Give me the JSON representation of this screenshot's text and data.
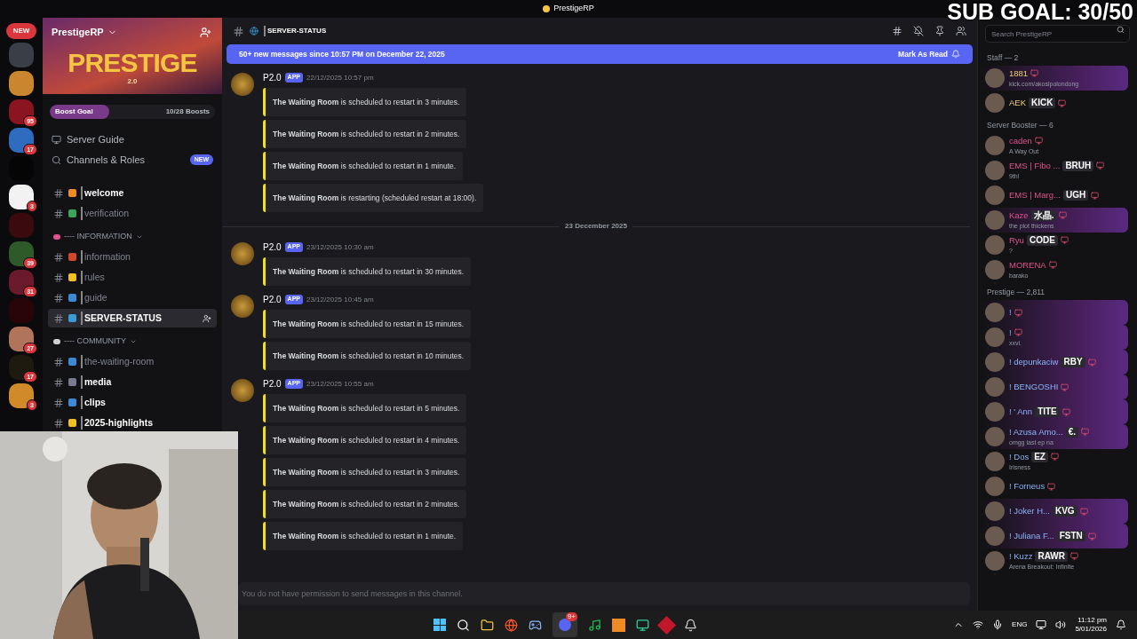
{
  "window": {
    "title": "PrestigeRP"
  },
  "overlay": {
    "sub_goal": "SUB GOAL: 30/50"
  },
  "rail": {
    "new_label": "NEW",
    "servers": [
      {
        "color": "#3a3f47"
      },
      {
        "color": "#c9862f"
      },
      {
        "color": "#8a1420",
        "badge": "95"
      },
      {
        "color": "#2f6bbf",
        "badge": "17"
      },
      {
        "color": "#050505"
      },
      {
        "color": "#f2f2f2",
        "badge": "3"
      },
      {
        "color": "#3a0a0e"
      },
      {
        "color": "#2e5a2a",
        "badge": "39"
      },
      {
        "color": "#6a1a2a",
        "badge": "31"
      },
      {
        "color": "#2a0508"
      },
      {
        "color": "#b0745a",
        "badge": "27"
      },
      {
        "color": "#1e1a10",
        "badge": "17"
      },
      {
        "color": "#d08a2a",
        "badge": "3"
      }
    ]
  },
  "server": {
    "name": "PrestigeRP",
    "banner_title": "PRESTIGE",
    "banner_sub": "2.0",
    "boost_label": "Boost Goal",
    "boost_count": "10/28 Boosts",
    "level": 0.36,
    "links": [
      {
        "label": "Server Guide"
      },
      {
        "label": "Channels & Roles",
        "badge": "NEW"
      }
    ]
  },
  "channels": [
    {
      "kind": "channel",
      "name": "welcome",
      "color": "#f08a24",
      "unread": true,
      "selected": false
    },
    {
      "kind": "channel",
      "name": "verification",
      "color": "#3ba55c",
      "unread": false,
      "selected": false
    },
    {
      "kind": "category",
      "name": "---- INFORMATION",
      "color": "#e0508c"
    },
    {
      "kind": "channel",
      "name": "information",
      "color": "#d04a2a",
      "unread": false,
      "selected": false
    },
    {
      "kind": "channel",
      "name": "rules",
      "color": "#f0c020",
      "unread": false,
      "selected": false
    },
    {
      "kind": "channel",
      "name": "guide",
      "color": "#3a8ad8",
      "unread": false,
      "selected": false
    },
    {
      "kind": "channel",
      "name": "SERVER-STATUS",
      "color": "#3a9ad8",
      "unread": true,
      "selected": true
    },
    {
      "kind": "category",
      "name": "---- COMMUNITY",
      "color": "#d0d0d0"
    },
    {
      "kind": "channel",
      "name": "the-waiting-room",
      "color": "#3a8ad8",
      "unread": false,
      "selected": false
    },
    {
      "kind": "channel",
      "name": "media",
      "color": "#7a7a90",
      "unread": true,
      "selected": false
    },
    {
      "kind": "channel",
      "name": "clips",
      "color": "#3a8ad8",
      "unread": true,
      "selected": false
    },
    {
      "kind": "channel",
      "name": "2025-highlights",
      "color": "#f0c020",
      "unread": true,
      "selected": false
    }
  ],
  "header": {
    "channel": "SERVER-STATUS",
    "search_placeholder": "Search PrestigeRP"
  },
  "banner": {
    "text": "50+ new messages since 10:57 PM on December 22, 2025",
    "action": "Mark As Read"
  },
  "messages": [
    {
      "kind": "group",
      "author": "P2.0",
      "tag": "APP",
      "time": "22/12/2025 10:57 pm",
      "embeds": [
        "**The Waiting Room** is scheduled to restart in 3 minutes.",
        "**The Waiting Room** is scheduled to restart in 2 minutes.",
        "**The Waiting Room** is scheduled to restart in 1 minute.",
        "**The Waiting Room** is restarting (scheduled restart at 18:00)."
      ]
    },
    {
      "kind": "divider",
      "label": "23 December 2025"
    },
    {
      "kind": "group",
      "author": "P2.0",
      "tag": "APP",
      "time": "23/12/2025 10:30 am",
      "embeds": [
        "**The Waiting Room** is scheduled to restart in 30 minutes."
      ]
    },
    {
      "kind": "group",
      "author": "P2.0",
      "tag": "APP",
      "time": "23/12/2025 10:45 am",
      "embeds": [
        "**The Waiting Room** is scheduled to restart in 15 minutes.",
        "**The Waiting Room** is scheduled to restart in 10 minutes."
      ]
    },
    {
      "kind": "group",
      "author": "P2.0",
      "tag": "APP",
      "time": "23/12/2025 10:55 am",
      "embeds": [
        "**The Waiting Room** is scheduled to restart in 5 minutes.",
        "**The Waiting Room** is scheduled to restart in 4 minutes.",
        "**The Waiting Room** is scheduled to restart in 3 minutes.",
        "**The Waiting Room** is scheduled to restart in 2 minutes.",
        "**The Waiting Room** is scheduled to restart in 1 minute."
      ]
    }
  ],
  "composer": {
    "placeholder": "You do not have permission to send messages in this channel."
  },
  "member_groups": [
    {
      "kind": "staff",
      "title": "Staff — 2",
      "members": [
        {
          "name": "1881",
          "activity": "kick.com/akosipolondong",
          "highlighted": true
        },
        {
          "name": "AEK",
          "tag": "KICK",
          "highlighted": false
        }
      ]
    },
    {
      "kind": "booster",
      "title": "Server Booster — 6",
      "members": [
        {
          "name": "caden",
          "activity": "A Way Out",
          "highlighted": false
        },
        {
          "name": "EMS | Fibo ...",
          "tag": "BRUH",
          "activity": "9th!",
          "highlighted": false
        },
        {
          "name": "EMS | Marg...",
          "tag": "UGH",
          "highlighted": false
        },
        {
          "name": "Kaze",
          "tag": "水晶.",
          "activity": "the plot thickens",
          "highlighted": true
        },
        {
          "name": "Ryu",
          "tag": "CODE",
          "activity": "?",
          "highlighted": false
        },
        {
          "name": "MORENA",
          "activity": "barako",
          "highlighted": false
        }
      ]
    },
    {
      "kind": "member",
      "title": "Prestige — 2,811",
      "members": [
        {
          "name": "!",
          "highlighted": true
        },
        {
          "name": "!",
          "activity": "xxvi.",
          "highlighted": true
        },
        {
          "name": "! depunkaciw",
          "tag": "RBY",
          "highlighted": true
        },
        {
          "name": "! BENGOSHI",
          "highlighted": true
        },
        {
          "name": "! ' Ann",
          "tag": "TITE",
          "highlighted": true
        },
        {
          "name": "! Azusa Amo...",
          "tag": "€.",
          "activity": "omgg last ep na",
          "highlighted": true
        },
        {
          "name": "! Dos",
          "tag": "EZ",
          "activity": "Irisness",
          "highlighted": false
        },
        {
          "name": "! Forneus",
          "highlighted": false
        },
        {
          "name": "! Joker H...",
          "tag": "KVG",
          "highlighted": true
        },
        {
          "name": "! Juliana F...",
          "tag": "FSTN",
          "highlighted": true
        },
        {
          "name": "! Kuzz",
          "tag": "RAWR",
          "activity": "Arena Breakout: Infinite",
          "highlighted": false
        }
      ]
    }
  ],
  "taskbar": {
    "discord_badge": "9+",
    "language": "ENG",
    "time": "11:12 pm",
    "date": "5/01/2026"
  }
}
